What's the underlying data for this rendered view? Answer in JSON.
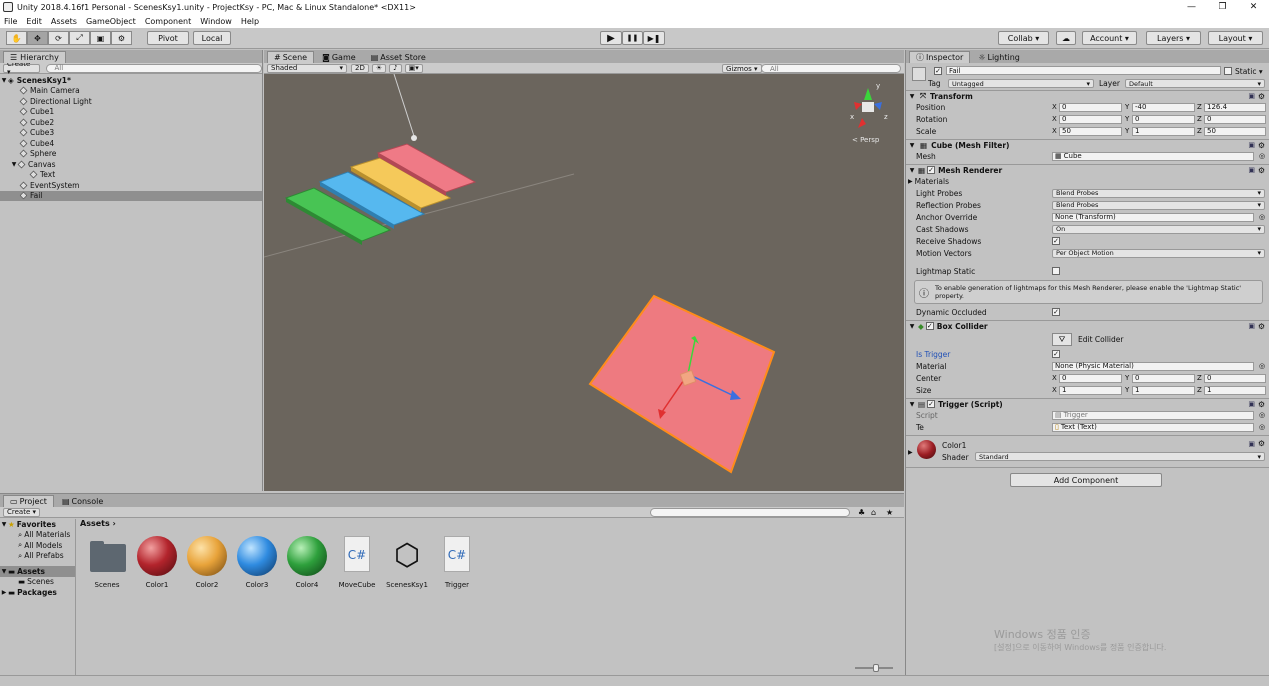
{
  "window": {
    "title": "Unity 2018.4.16f1 Personal - ScenesKsy1.unity - ProjectKsy - PC, Mac & Linux Standalone* <DX11>",
    "minimize": "—",
    "maximize": "❐",
    "close": "✕"
  },
  "menu": [
    "File",
    "Edit",
    "Assets",
    "GameObject",
    "Component",
    "Window",
    "Help"
  ],
  "toolbar": {
    "pivot": "Pivot",
    "local": "Local",
    "play": "▶",
    "pause": "❚❚",
    "step": "▶❚",
    "collab": "Collab ▾",
    "cloud": "☁",
    "account": "Account ▾",
    "layers": "Layers ▾",
    "layout": "Layout ▾",
    "tools": [
      "✋",
      "✥",
      "⟳",
      "⤢",
      "▣",
      "⚙"
    ]
  },
  "hierarchy": {
    "tab": "Hierarchy",
    "create": "Create ▾",
    "search": "All",
    "scene": "ScenesKsy1*",
    "items": [
      {
        "label": "Main Camera",
        "indent": 1
      },
      {
        "label": "Directional Light",
        "indent": 1
      },
      {
        "label": "Cube1",
        "indent": 1
      },
      {
        "label": "Cube2",
        "indent": 1
      },
      {
        "label": "Cube3",
        "indent": 1
      },
      {
        "label": "Cube4",
        "indent": 1
      },
      {
        "label": "Sphere",
        "indent": 1
      },
      {
        "label": "Canvas",
        "indent": 1
      },
      {
        "label": "Text",
        "indent": 2
      },
      {
        "label": "EventSystem",
        "indent": 1
      },
      {
        "label": "Fail",
        "indent": 1
      }
    ]
  },
  "scene": {
    "tabs": [
      "Scene",
      "Game",
      "Asset Store"
    ],
    "shaded": "Shaded",
    "mode2d": "2D",
    "gizmos": "Gizmos ▾",
    "search": "All",
    "persp": "< Persp",
    "axis": {
      "x": "x",
      "y": "y",
      "z": "z"
    }
  },
  "project": {
    "tabs": [
      "Project",
      "Console"
    ],
    "create": "Create ▾",
    "favorites": "Favorites",
    "fav_items": [
      "All Materials",
      "All Models",
      "All Prefabs"
    ],
    "assets_root": "Assets",
    "asset_sub": [
      "Scenes"
    ],
    "packages": "Packages",
    "breadcrumb": "Assets ›",
    "assets": [
      {
        "name": "Scenes",
        "kind": "folder"
      },
      {
        "name": "Color1",
        "kind": "sphere",
        "color": "#b3242c"
      },
      {
        "name": "Color2",
        "kind": "sphere",
        "color": "#e8a33a"
      },
      {
        "name": "Color3",
        "kind": "sphere",
        "color": "#2f8be0"
      },
      {
        "name": "Color4",
        "kind": "sphere",
        "color": "#2ea03c"
      },
      {
        "name": "MoveCube",
        "kind": "script"
      },
      {
        "name": "ScenesKsy1",
        "kind": "unity"
      },
      {
        "name": "Trigger",
        "kind": "script"
      }
    ]
  },
  "inspector": {
    "tabs": [
      "Inspector",
      "Lighting"
    ],
    "object_name": "Fail",
    "static": "Static ▾",
    "tag_label": "Tag",
    "tag": "Untagged",
    "layer_label": "Layer",
    "layer": "Default",
    "transform": {
      "title": "Transform",
      "rows": [
        {
          "label": "Position",
          "x": "0",
          "y": "-40",
          "z": "126.4"
        },
        {
          "label": "Rotation",
          "x": "0",
          "y": "0",
          "z": "0"
        },
        {
          "label": "Scale",
          "x": "50",
          "y": "1",
          "z": "50"
        }
      ]
    },
    "mesh_filter": {
      "title": "Cube (Mesh Filter)",
      "mesh_label": "Mesh",
      "mesh": "Cube"
    },
    "mesh_renderer": {
      "title": "Mesh Renderer",
      "materials": "Materials",
      "light_probes_label": "Light Probes",
      "light_probes": "Blend Probes",
      "reflection_label": "Reflection Probes",
      "reflection": "Blend Probes",
      "anchor_label": "Anchor Override",
      "anchor": "None (Transform)",
      "cast_label": "Cast Shadows",
      "cast": "On",
      "receive_label": "Receive Shadows",
      "motion_label": "Motion Vectors",
      "motion": "Per Object Motion",
      "lightmap_label": "Lightmap Static",
      "info": "To enable generation of lightmaps for this Mesh Renderer, please enable the 'Lightmap Static' property.",
      "dynamic_label": "Dynamic Occluded"
    },
    "box_collider": {
      "title": "Box Collider",
      "edit": "Edit Collider",
      "trigger_label": "Is Trigger",
      "material_label": "Material",
      "material": "None (Physic Material)",
      "center_label": "Center",
      "cx": "0",
      "cy": "0",
      "cz": "0",
      "size_label": "Size",
      "sx": "1",
      "sy": "1",
      "sz": "1"
    },
    "trigger_script": {
      "title": "Trigger (Script)",
      "script_label": "Script",
      "script": "Trigger",
      "te_label": "Te",
      "te": "Text (Text)"
    },
    "material": {
      "name": "Color1",
      "shader_label": "Shader",
      "shader": "Standard",
      "color": "#9c1e24"
    },
    "add_component": "Add Component"
  },
  "watermark": {
    "line1": "Windows 정품 인증",
    "line2": "[설정]으로 이동하여 Windows를 정품 인증합니다."
  }
}
